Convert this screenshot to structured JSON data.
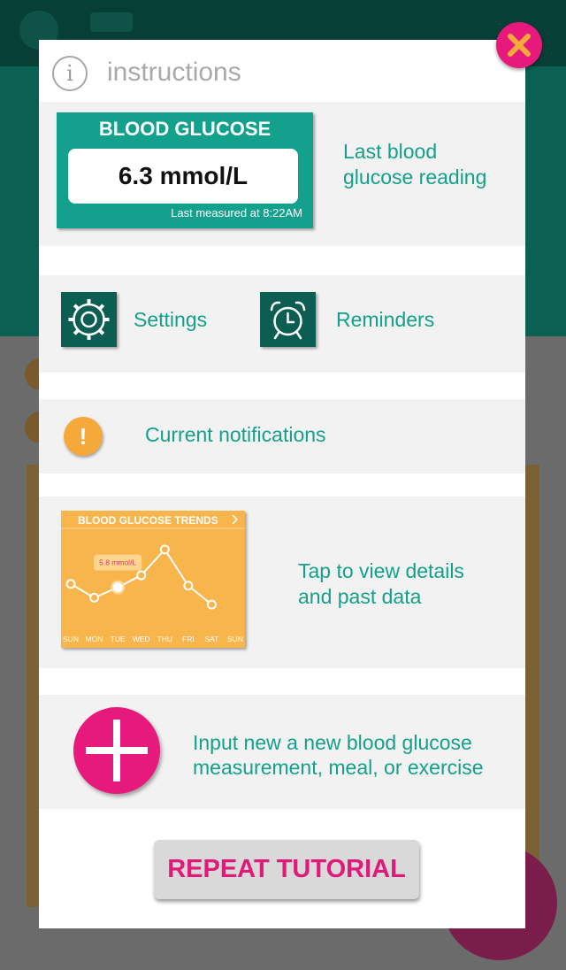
{
  "header": {
    "title": "instructions",
    "info_icon": "info-icon"
  },
  "glucose_card": {
    "title": "BLOOD GLUCOSE",
    "value": "6.3 mmol/L",
    "last_measured": "Last measured at 8:22AM",
    "description": "Last blood glucose reading"
  },
  "settings": {
    "label": "Settings",
    "icon": "gear-icon"
  },
  "reminders": {
    "label": "Reminders",
    "icon": "alarm-clock-icon"
  },
  "notifications": {
    "label": "Current notifications",
    "icon": "exclamation-icon"
  },
  "trends": {
    "description": "Tap to view details and past data"
  },
  "add": {
    "description": "Input new a new blood glucose measurement, meal, or exercise",
    "icon": "plus-icon"
  },
  "repeat_button": "REPEAT TUTORIAL",
  "colors": {
    "teal": "#13a08c",
    "dark_teal": "#0c5d52",
    "pink": "#e8197d",
    "orange": "#f8b54b",
    "warning": "#f6a93b"
  },
  "chart_data": {
    "type": "line",
    "title": "BLOOD GLUCOSE TRENDS",
    "categories": [
      "SUN",
      "MON",
      "TUE",
      "WED",
      "THU",
      "FRI",
      "SAT",
      "SUN"
    ],
    "values": [
      6.0,
      5.2,
      5.8,
      6.5,
      8.0,
      5.9,
      4.8,
      null
    ],
    "highlight": {
      "index": 2,
      "label": "5.8 mmol/L"
    },
    "grid": false
  }
}
